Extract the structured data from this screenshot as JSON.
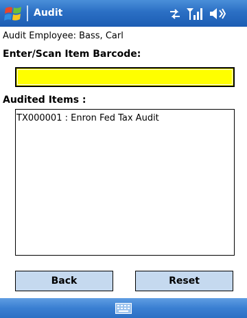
{
  "titlebar": {
    "title": "Audit",
    "start_icon": "windows-flag-icon",
    "tray_icons": [
      "connectivity-icon",
      "signal-strength-icon",
      "volume-icon"
    ]
  },
  "audit": {
    "employee_text": "Audit Employee: Bass, Carl",
    "barcode_label": "Enter/Scan Item Barcode:",
    "barcode_value": "",
    "audited_label": "Audited Items :",
    "audited_items": [
      "TX000001 : Enron Fed Tax Audit"
    ]
  },
  "buttons": {
    "back_label": "Back",
    "reset_label": "Reset"
  },
  "menubar": {
    "input_icon": "keyboard-icon"
  },
  "colors": {
    "titlebar": "#2b6fc4",
    "input_background": "#ffff00",
    "button_background": "#c5d9ef",
    "menubar": "#3a7fd2"
  }
}
